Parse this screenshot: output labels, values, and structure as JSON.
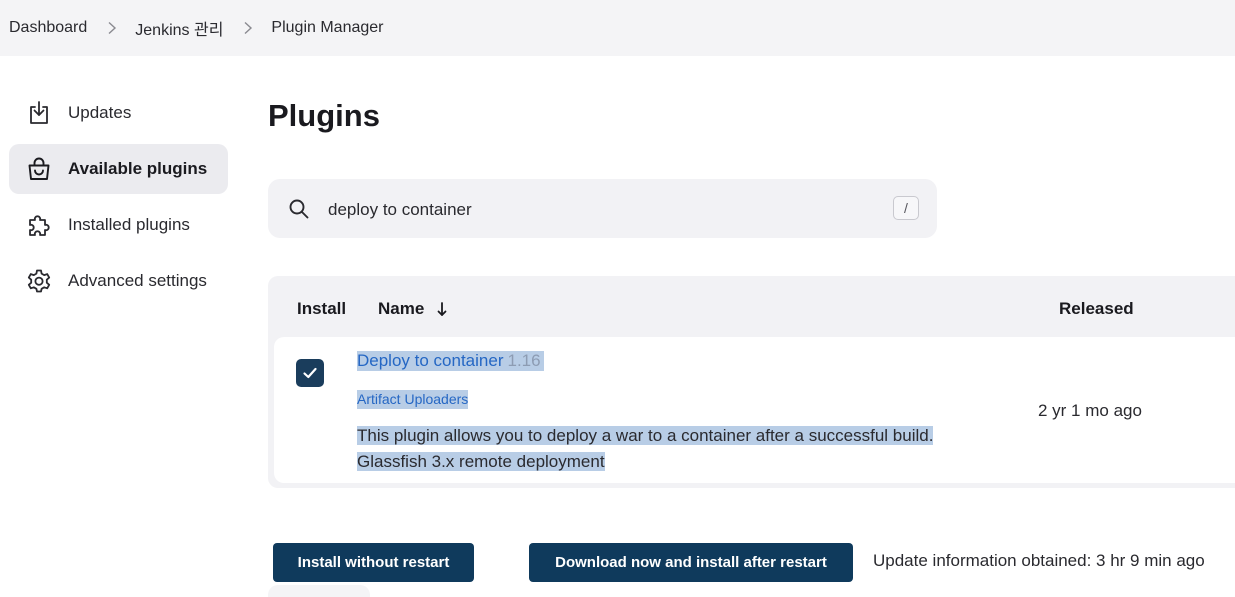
{
  "breadcrumb": [
    "Dashboard",
    "Jenkins 관리",
    "Plugin Manager"
  ],
  "sidebar": {
    "items": [
      {
        "label": "Updates",
        "icon": "download-icon",
        "active": false
      },
      {
        "label": "Available plugins",
        "icon": "shopping-bag-icon",
        "active": true
      },
      {
        "label": "Installed plugins",
        "icon": "puzzle-icon",
        "active": false
      },
      {
        "label": "Advanced settings",
        "icon": "gear-icon",
        "active": false
      }
    ]
  },
  "page": {
    "title": "Plugins"
  },
  "search": {
    "value": "deploy to container",
    "shortcut": "/"
  },
  "table": {
    "headers": {
      "install": "Install",
      "name": "Name",
      "sort_indicator": "↓",
      "released": "Released"
    },
    "rows": [
      {
        "checked": true,
        "name": "Deploy to container",
        "version": "1.16",
        "category": "Artifact Uploaders",
        "description_lines": [
          "This plugin allows you to deploy a war to a container after a successful build.",
          "Glassfish 3.x remote deployment"
        ],
        "released": "2 yr 1 mo ago"
      }
    ]
  },
  "actions": {
    "install_without_restart": "Install without restart",
    "download_and_install": "Download now and install after restart"
  },
  "update_info": "Update information obtained: 3 hr 9 min ago",
  "colors": {
    "primary_button": "#0f3a5c",
    "link": "#2567c4",
    "selection_highlight": "#b8cde6"
  }
}
